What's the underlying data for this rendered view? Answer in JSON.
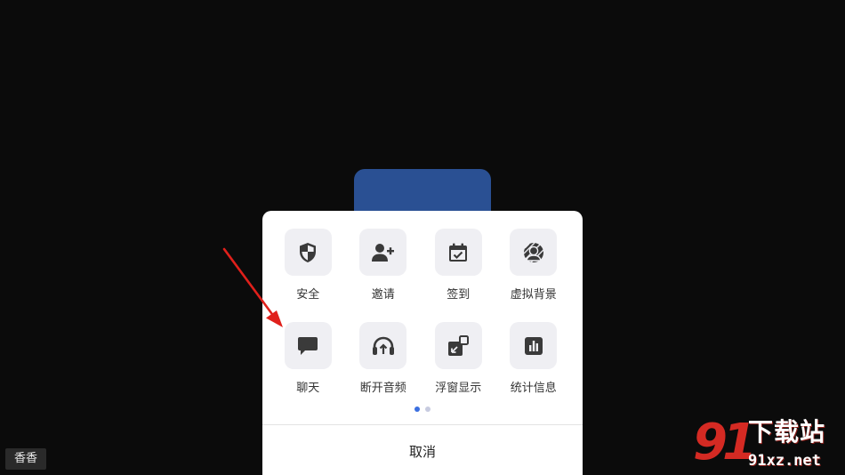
{
  "participant": {
    "name": "香香"
  },
  "menu": {
    "rows": [
      [
        {
          "label": "安全",
          "icon": "shield-icon"
        },
        {
          "label": "邀请",
          "icon": "add-user-icon"
        },
        {
          "label": "签到",
          "icon": "calendar-check-icon"
        },
        {
          "label": "虚拟背景",
          "icon": "virtual-background-icon"
        }
      ],
      [
        {
          "label": "聊天",
          "icon": "chat-icon"
        },
        {
          "label": "断开音频",
          "icon": "headphones-icon"
        },
        {
          "label": "浮窗显示",
          "icon": "floating-window-icon"
        },
        {
          "label": "统计信息",
          "icon": "statistics-icon"
        }
      ]
    ],
    "page_indicator": {
      "pages": 2,
      "current": 1
    },
    "cancel_label": "取消"
  },
  "watermark": {
    "brand": "91",
    "title": "下载站",
    "domain": "91xz.net"
  },
  "colors": {
    "background": "#0b0b0b",
    "video_tile": "#2a5093",
    "icon_tile": "#efeff3",
    "icon": "#3a3a3a",
    "dot_active": "#3b6fe0",
    "arrow": "#e0201b"
  }
}
